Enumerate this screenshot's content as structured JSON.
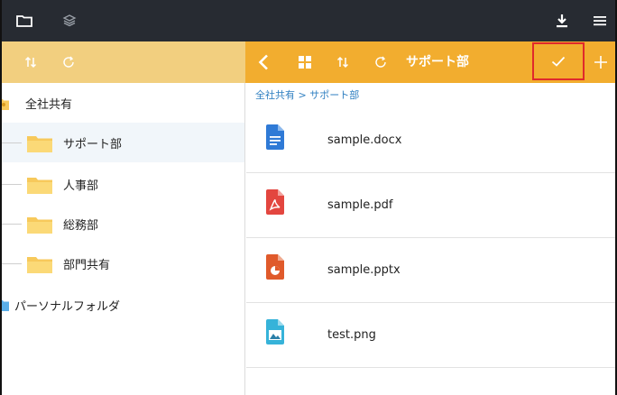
{
  "colors": {
    "topbar": "#272b32",
    "left_header": "#f2cf7f",
    "right_header": "#f2ad2f",
    "folder_yellow": "#f7c95b",
    "breadcrumb_link": "#2f7fc1",
    "highlight_border": "#e0292b"
  },
  "topbar": {
    "left_icons": [
      "folder-outline-icon",
      "layers-icon"
    ],
    "right_icons": [
      "download-icon",
      "menu-icon"
    ]
  },
  "left_header": {
    "icons": [
      "sort-icon",
      "refresh-icon"
    ]
  },
  "right_header": {
    "icons": [
      "back-chevron-icon",
      "grid-view-icon",
      "sort-icon",
      "refresh-icon"
    ],
    "title": "サポート部",
    "action_icons": [
      "checkmark-icon",
      "plus-icon"
    ]
  },
  "tree": {
    "items": [
      {
        "label": "全社共有",
        "icon": "shared-folder-icon",
        "selected": false
      },
      {
        "label": "サポート部",
        "icon": "folder-icon",
        "selected": true
      },
      {
        "label": "人事部",
        "icon": "folder-icon",
        "selected": false
      },
      {
        "label": "総務部",
        "icon": "folder-icon",
        "selected": false
      },
      {
        "label": "部門共有",
        "icon": "folder-icon",
        "selected": false
      },
      {
        "label": "パーソナルフォルダ",
        "icon": "personal-folder-icon",
        "selected": false
      }
    ]
  },
  "breadcrumb": "全社共有 > サポート部",
  "files": [
    {
      "name": "sample.docx",
      "icon": "word-document-icon",
      "color": "#2f7ad6"
    },
    {
      "name": "sample.pdf",
      "icon": "pdf-document-icon",
      "color": "#e3463f"
    },
    {
      "name": "sample.pptx",
      "icon": "powerpoint-document-icon",
      "color": "#e05a2b"
    },
    {
      "name": "test.png",
      "icon": "image-file-icon",
      "color": "#36b3d9"
    }
  ]
}
